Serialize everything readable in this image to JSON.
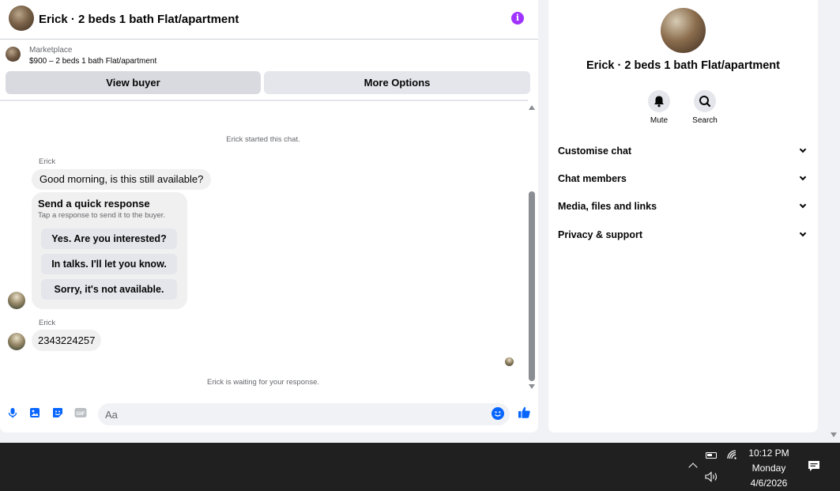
{
  "header": {
    "title": "Erick · 2 beds 1 bath Flat/apartment",
    "info_icon_glyph": "i"
  },
  "marketplace": {
    "label": "Marketplace",
    "listing": "$900 – 2 beds 1 bath Flat/apartment"
  },
  "actions": {
    "view_buyer": "View buyer",
    "more_options": "More Options"
  },
  "messages": {
    "started": "Erick started this chat.",
    "sender_1": "Erick",
    "msg_1": "Good morning, is this still available?",
    "quick_response": {
      "title": "Send a quick response",
      "subtitle": "Tap a response to send it to the buyer.",
      "options": [
        "Yes. Are you interested?",
        "In talks. I'll let you know.",
        "Sorry, it's not available."
      ]
    },
    "sender_2": "Erick",
    "msg_2": "2343224257",
    "waiting": "Erick is waiting for your response."
  },
  "composer": {
    "placeholder": "Aa",
    "gif_label": "GIF"
  },
  "info_panel": {
    "title": "Erick · 2 beds 1 bath Flat/apartment",
    "mute_label": "Mute",
    "search_label": "Search",
    "sections": [
      "Customise chat",
      "Chat members",
      "Media, files and links",
      "Privacy & support"
    ]
  },
  "taskbar": {
    "time": "10:12 PM",
    "day": "Monday",
    "date": "4/6/2026"
  },
  "colors": {
    "accent": "#0866ff",
    "info": "#a033ff",
    "taskbar": "#202020"
  }
}
